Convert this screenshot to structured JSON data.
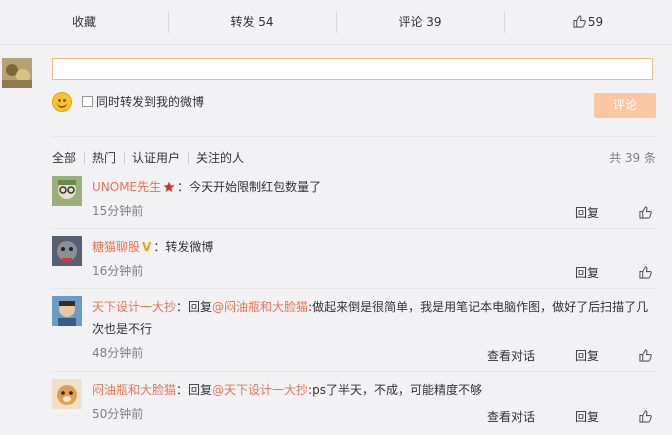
{
  "tabs": {
    "collect": "收藏",
    "forward": "转发 54",
    "comment": "评论 39",
    "like": "59"
  },
  "composer": {
    "input_value": "",
    "forward_label": "同时转发到我的微博",
    "submit_label": "评论"
  },
  "filters": [
    "全部",
    "热门",
    "认证用户",
    "关注的人"
  ],
  "total": "共 39 条",
  "comments": [
    {
      "name": "UNOME先生",
      "badge": "star",
      "sep": "：",
      "reply_prefix": "",
      "mention": "",
      "text": "今天开始限制红包数量了",
      "time": "15分钟前",
      "view": "",
      "reply": "回复"
    },
    {
      "name": "糖猫聊股",
      "badge": "V",
      "sep": "：",
      "reply_prefix": "",
      "mention": "",
      "text": "转发微博",
      "time": "16分钟前",
      "view": "",
      "reply": "回复"
    },
    {
      "name": "天下设计一大抄",
      "badge": "",
      "sep": "：",
      "reply_prefix": "回复",
      "mention": "@闷油瓶和大脸猫",
      "text": ":做起来倒是很简单，我是用笔记本电脑作图，做好了后扫描了几次也是不行",
      "time": "48分钟前",
      "view": "查看对话",
      "reply": "回复"
    },
    {
      "name": "闷油瓶和大脸猫",
      "badge": "",
      "sep": "：",
      "reply_prefix": "回复",
      "mention": "@天下设计一大抄",
      "text": ":ps了半天，不成，可能精度不够",
      "time": "50分钟前",
      "view": "查看对话",
      "reply": "回复"
    }
  ]
}
